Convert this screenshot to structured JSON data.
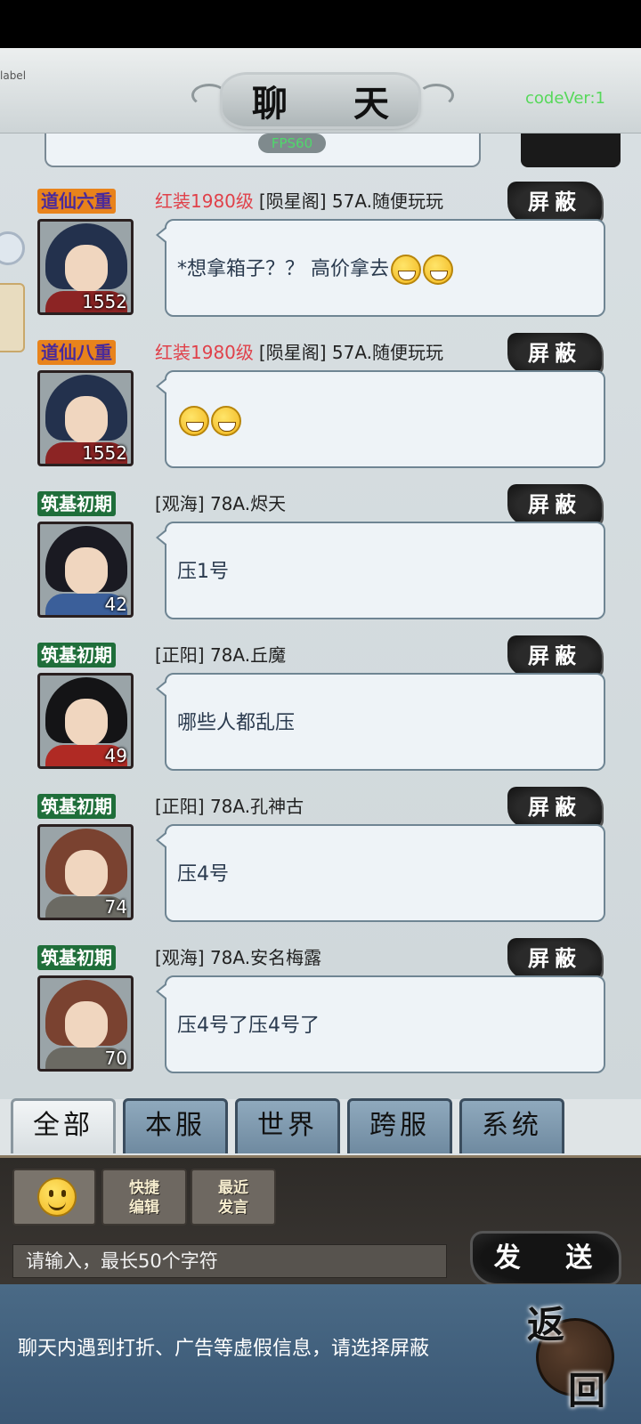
{
  "header": {
    "debug_label": "label",
    "title": "聊 天",
    "version": "codeVer:1",
    "fps": "FPS60"
  },
  "messages": [
    {
      "realm": "道仙六重",
      "realm_style": "orange",
      "level": "1552",
      "outfit": "红装1980级",
      "info": "[陨星阁] 57A.随便玩玩",
      "text": "*想拿箱子？？ 高价拿去",
      "emoji_count": 2,
      "avatar_hair": "#23314d",
      "avatar_body": "#8c2424",
      "block": "屏蔽"
    },
    {
      "realm": "道仙八重",
      "realm_style": "orange",
      "level": "1552",
      "outfit": "红装1980级",
      "info": "[陨星阁] 57A.随便玩玩",
      "text": "",
      "emoji_count": 2,
      "avatar_hair": "#23314d",
      "avatar_body": "#8c2424",
      "block": "屏蔽"
    },
    {
      "realm": "筑基初期",
      "realm_style": "green",
      "level": "42",
      "outfit": "",
      "info": "[观海] 78A.烬天",
      "text": "压1号",
      "emoji_count": 0,
      "avatar_hair": "#1a1a22",
      "avatar_body": "#3b5f9a",
      "block": "屏蔽"
    },
    {
      "realm": "筑基初期",
      "realm_style": "green",
      "level": "49",
      "outfit": "",
      "info": "[正阳] 78A.丘魔",
      "text": "哪些人都乱压",
      "emoji_count": 0,
      "avatar_hair": "#141416",
      "avatar_body": "#b02a24",
      "block": "屏蔽"
    },
    {
      "realm": "筑基初期",
      "realm_style": "green",
      "level": "74",
      "outfit": "",
      "info": "[正阳] 78A.孔神古",
      "text": "压4号",
      "emoji_count": 0,
      "avatar_hair": "#7a4230",
      "avatar_body": "#6b6a63",
      "block": "屏蔽"
    },
    {
      "realm": "筑基初期",
      "realm_style": "green",
      "level": "70",
      "outfit": "",
      "info": "[观海] 78A.安名梅露",
      "text": "压4号了压4号了",
      "emoji_count": 0,
      "avatar_hair": "#7a4230",
      "avatar_body": "#6b6a63",
      "block": "屏蔽"
    }
  ],
  "tabs": [
    "全部",
    "本服",
    "世界",
    "跨服",
    "系统"
  ],
  "active_tab": 0,
  "input_panel": {
    "quick_edit": [
      "快捷",
      "编辑"
    ],
    "recent": [
      "最近",
      "发言"
    ],
    "placeholder": "请输入，最长50个字符",
    "send": "发 送"
  },
  "notice": "聊天内遇到打折、广告等虚假信息，请选择屏蔽",
  "back": {
    "top": "返",
    "bottom": "回"
  }
}
